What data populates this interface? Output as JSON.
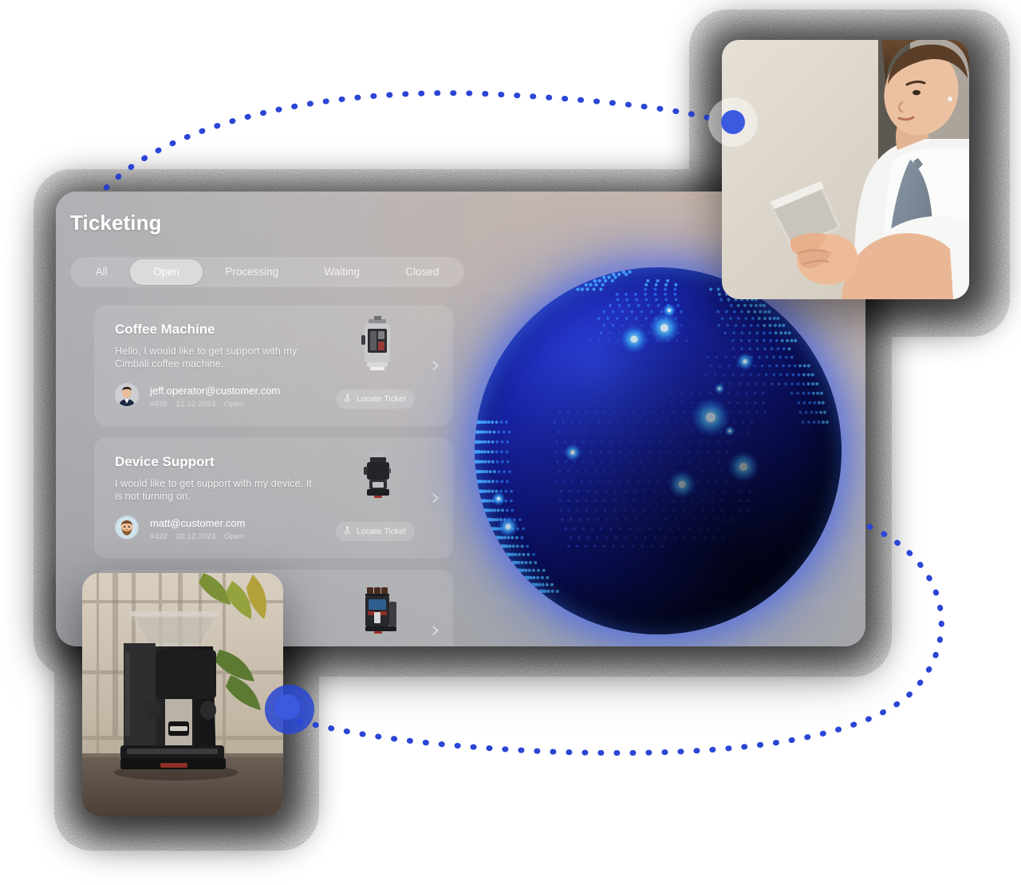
{
  "app": {
    "title": "Ticketing",
    "mic_icon": "microphone-icon"
  },
  "tabs": [
    {
      "label": "All",
      "active": false
    },
    {
      "label": "Open",
      "active": true
    },
    {
      "label": "Processing",
      "active": false
    },
    {
      "label": "Waiting",
      "active": false
    },
    {
      "label": "Closed",
      "active": false
    }
  ],
  "tickets": [
    {
      "title": "Coffee Machine",
      "description": "Hello, I would like to get support with my Cimbali coffee machine.",
      "email": "jeff.operator@customer.com",
      "ticket_id": "#435",
      "date": "21.12.2023",
      "status": "Open",
      "action_label": "Locate Ticket",
      "action_icon": "locate-pin-icon",
      "chevron_icon": "chevron-right-icon",
      "avatar_name": "avatar-jeff",
      "thumb_name": "coffee-machine-thumbnail"
    },
    {
      "title": "Device Support",
      "description": "I would like to get support with my device. It is not turning on.",
      "email": "matt@customer.com",
      "ticket_id": "#432",
      "date": "20.12.2023",
      "status": "Open",
      "action_label": "Locate Ticket",
      "action_icon": "locate-pin-icon",
      "chevron_icon": "chevron-right-icon",
      "avatar_name": "avatar-matt",
      "thumb_name": "grinder-thumbnail"
    },
    {
      "title": "",
      "description": "",
      "email": "",
      "ticket_id": "",
      "date": "",
      "status": "",
      "action_label": "",
      "action_icon": "",
      "chevron_icon": "chevron-right-icon",
      "avatar_name": "avatar-hidden",
      "thumb_name": "espresso-machine-thumbnail"
    }
  ],
  "photos": [
    {
      "name": "photo-barista-phone",
      "alt": "Woman in apron looking at smartphone"
    },
    {
      "name": "photo-coffee-machine",
      "alt": "Black coffee machine on wooden table by a window"
    }
  ],
  "globe": {
    "name": "world-globe-visualization",
    "node_count": 12
  },
  "colors": {
    "accent_blue": "#2b45d6",
    "node_blue": "#3b5ae0",
    "globe_core": "#1a25a8",
    "globe_dot": "#3c7cff",
    "panel_light": "#b9b6b6",
    "panel_dark": "#9a9c9f",
    "text_primary": "#ffffff",
    "text_muted": "#dcdcde"
  }
}
